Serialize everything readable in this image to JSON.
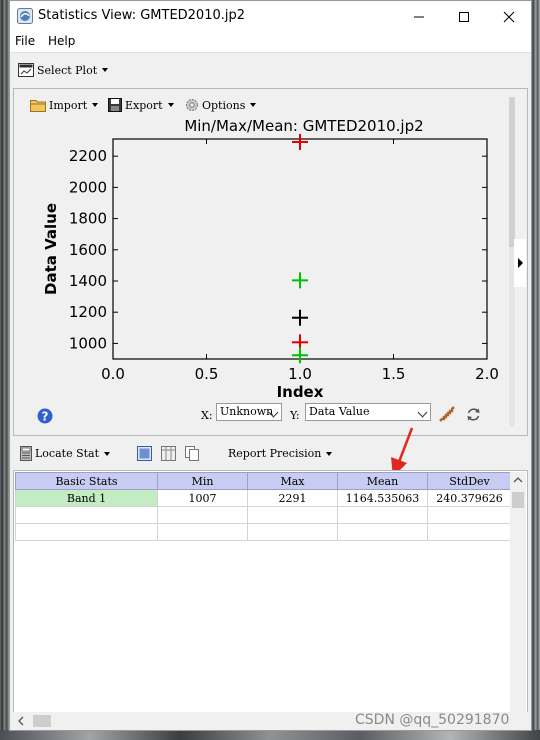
{
  "window": {
    "title": "Statistics View: GMTED2010.jp2"
  },
  "menu": {
    "file": "File",
    "help": "Help"
  },
  "toolbar": {
    "select_plot": "Select Plot"
  },
  "plot_toolbar": {
    "import": "Import",
    "export": "Export",
    "options": "Options"
  },
  "chart_data": {
    "type": "scatter",
    "title": "Min/Max/Mean: GMTED2010.jp2",
    "xlabel": "Index",
    "ylabel": "Data Value",
    "xlim": [
      0.0,
      2.0
    ],
    "ylim": [
      900,
      2310
    ],
    "x_ticks": [
      "0.0",
      "0.5",
      "1.0",
      "1.5",
      "2.0"
    ],
    "y_ticks": [
      "1000",
      "1200",
      "1400",
      "1600",
      "1800",
      "2000",
      "2200"
    ],
    "marker": "plus",
    "grid": false,
    "series": [
      {
        "x": 1.0,
        "y": 2291,
        "color": "#e00000"
      },
      {
        "x": 1.0,
        "y": 1404,
        "color": "#00c000"
      },
      {
        "x": 1.0,
        "y": 1164.535063,
        "color": "#000000"
      },
      {
        "x": 1.0,
        "y": 1007,
        "color": "#e00000"
      },
      {
        "x": 1.0,
        "y": 924,
        "color": "#00c000"
      }
    ]
  },
  "axis_controls": {
    "x_label": "X:",
    "x_value": "Unknown",
    "y_label": "Y:",
    "y_value": "Data Value"
  },
  "stats_toolbar": {
    "locate_stat": "Locate Stat",
    "report_precision": "Report Precision"
  },
  "table": {
    "headers": [
      "Basic Stats",
      "Min",
      "Max",
      "Mean",
      "StdDev"
    ],
    "rows": [
      [
        "Band 1",
        "1007",
        "2291",
        "1164.535063",
        "240.379626"
      ],
      [
        "",
        "",
        "",
        "",
        ""
      ],
      [
        "",
        "",
        "",
        "",
        ""
      ]
    ]
  },
  "watermark": "CSDN @qq_50291870",
  "colors": {
    "header": "#c8cbf2",
    "rowhead": "#c3ecc3",
    "annotation_arrow": "#e0281e"
  }
}
